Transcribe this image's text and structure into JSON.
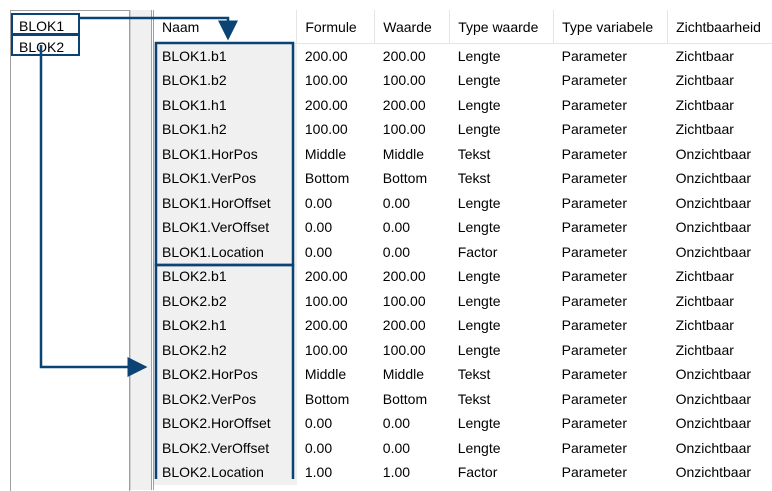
{
  "tree": {
    "items": [
      "BLOK1",
      "BLOK2"
    ]
  },
  "grid": {
    "columns": [
      "Naam",
      "Formule",
      "Waarde",
      "Type waarde",
      "Type variabele",
      "Zichtbaarheid"
    ],
    "rows": [
      [
        "BLOK1.b1",
        "200.00",
        "200.00",
        "Lengte",
        "Parameter",
        "Zichtbaar"
      ],
      [
        "BLOK1.b2",
        "100.00",
        "100.00",
        "Lengte",
        "Parameter",
        "Zichtbaar"
      ],
      [
        "BLOK1.h1",
        "200.00",
        "200.00",
        "Lengte",
        "Parameter",
        "Zichtbaar"
      ],
      [
        "BLOK1.h2",
        "100.00",
        "100.00",
        "Lengte",
        "Parameter",
        "Zichtbaar"
      ],
      [
        "BLOK1.HorPos",
        "Middle",
        "Middle",
        "Tekst",
        "Parameter",
        "Onzichtbaar"
      ],
      [
        "BLOK1.VerPos",
        "Bottom",
        "Bottom",
        "Tekst",
        "Parameter",
        "Onzichtbaar"
      ],
      [
        "BLOK1.HorOffset",
        "0.00",
        "0.00",
        "Lengte",
        "Parameter",
        "Onzichtbaar"
      ],
      [
        "BLOK1.VerOffset",
        "0.00",
        "0.00",
        "Lengte",
        "Parameter",
        "Onzichtbaar"
      ],
      [
        "BLOK1.Location",
        "0.00",
        "0.00",
        "Factor",
        "Parameter",
        "Onzichtbaar"
      ],
      [
        "BLOK2.b1",
        "200.00",
        "200.00",
        "Lengte",
        "Parameter",
        "Zichtbaar"
      ],
      [
        "BLOK2.b2",
        "100.00",
        "100.00",
        "Lengte",
        "Parameter",
        "Zichtbaar"
      ],
      [
        "BLOK2.h1",
        "200.00",
        "200.00",
        "Lengte",
        "Parameter",
        "Zichtbaar"
      ],
      [
        "BLOK2.h2",
        "100.00",
        "100.00",
        "Lengte",
        "Parameter",
        "Zichtbaar"
      ],
      [
        "BLOK2.HorPos",
        "Middle",
        "Middle",
        "Tekst",
        "Parameter",
        "Onzichtbaar"
      ],
      [
        "BLOK2.VerPos",
        "Bottom",
        "Bottom",
        "Tekst",
        "Parameter",
        "Onzichtbaar"
      ],
      [
        "BLOK2.HorOffset",
        "0.00",
        "0.00",
        "Lengte",
        "Parameter",
        "Onzichtbaar"
      ],
      [
        "BLOK2.VerOffset",
        "0.00",
        "0.00",
        "Lengte",
        "Parameter",
        "Onzichtbaar"
      ],
      [
        "BLOK2.Location",
        "1.00",
        "1.00",
        "Factor",
        "Parameter",
        "Onzichtbaar"
      ]
    ]
  },
  "annotation_color": "#0b4474"
}
